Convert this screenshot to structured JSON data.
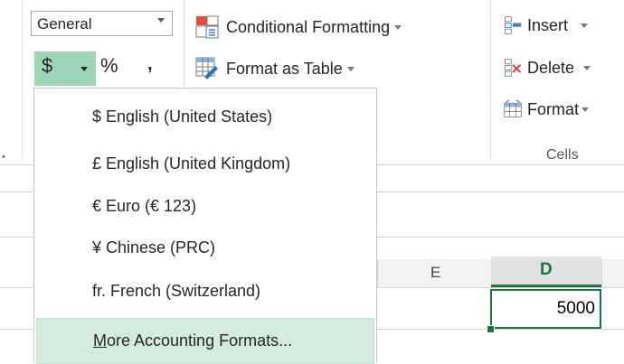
{
  "ribbon": {
    "number_group": {
      "number_format_value": "General",
      "accounting_symbol": "$",
      "percent_symbol": "%",
      "comma_symbol": ","
    },
    "styles_group": {
      "conditional_formatting_label": "Conditional Formatting",
      "format_as_table_label": "Format as Table"
    },
    "cells_group": {
      "insert_label": "Insert",
      "delete_label": "Delete",
      "format_label": "Format",
      "group_label": "Cells"
    }
  },
  "accounting_menu": {
    "items": [
      {
        "label": "$ English (United States)"
      },
      {
        "label": "£ English (United Kingdom)"
      },
      {
        "label": "€ Euro (€ 123)"
      },
      {
        "label": "¥ Chinese (PRC)"
      },
      {
        "label": "fr. French (Switzerland)"
      }
    ],
    "more": {
      "accelerator": "M",
      "rest": "ore Accounting Formats..."
    }
  },
  "sheet": {
    "column_headers": [
      "E",
      "D"
    ],
    "active_cell_value": "5000"
  },
  "colors": {
    "accent_green": "#217346",
    "pressed_button": "#9fd5b7",
    "menu_hover": "#d3ecde"
  }
}
